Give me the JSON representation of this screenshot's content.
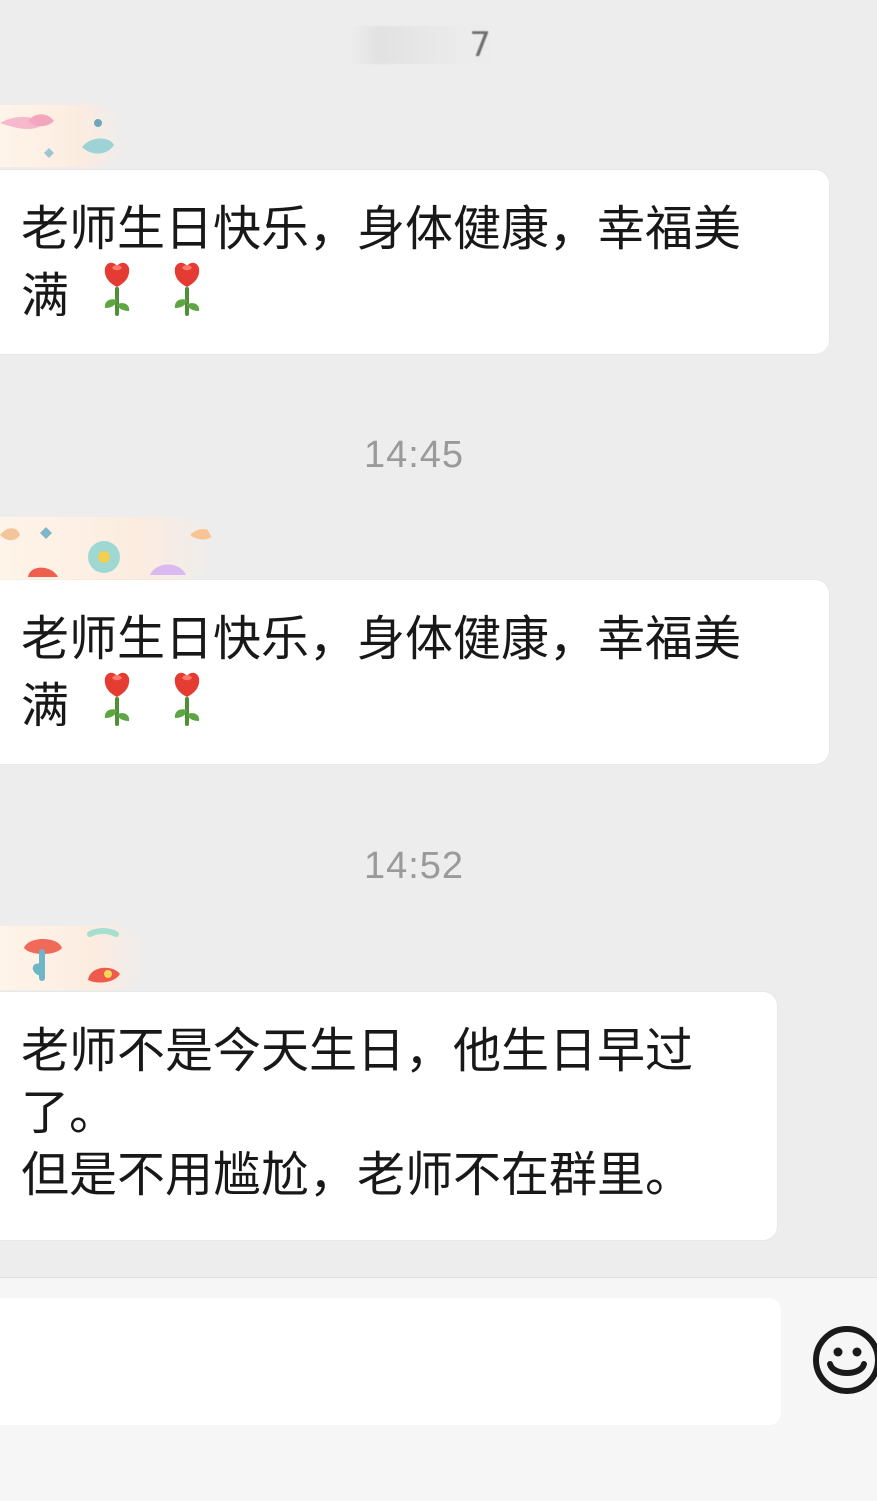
{
  "header": {
    "fragment_text": "7"
  },
  "messages": [
    {
      "kind": "text",
      "lines": [
        "老师生日快乐，身体健康，幸福美",
        "满"
      ],
      "trailing_icons": [
        "rose-icon",
        "rose-icon"
      ]
    },
    {
      "kind": "timestamp",
      "text": "14:45"
    },
    {
      "kind": "text",
      "lines": [
        "老师生日快乐，身体健康，幸福美",
        "满"
      ],
      "trailing_icons": [
        "rose-icon",
        "rose-icon"
      ]
    },
    {
      "kind": "timestamp",
      "text": "14:52"
    },
    {
      "kind": "text",
      "lines": [
        "老师不是今天生日，他生日早过",
        "了。",
        "但是不用尴尬，老师不在群里。"
      ],
      "trailing_icons": []
    }
  ],
  "composer": {
    "input_value": "",
    "emoji_button_icon": "smiley-face-icon"
  },
  "colors": {
    "background": "#ededed",
    "bubble": "#ffffff",
    "timestamp_text": "#9a9a9a",
    "message_text": "#181818",
    "rose_red": "#e43b32",
    "rose_green": "#4f8f35"
  }
}
